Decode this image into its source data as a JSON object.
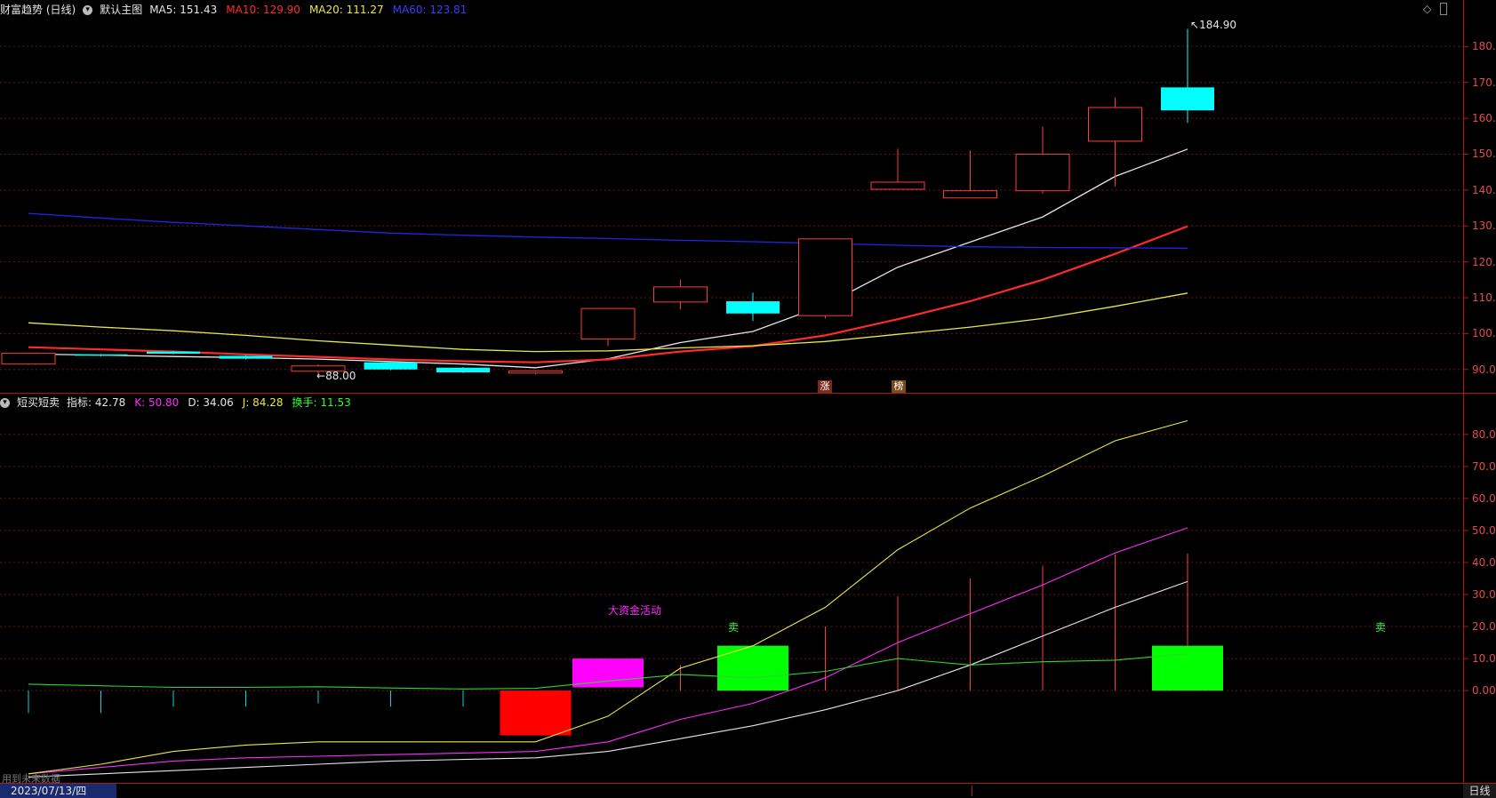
{
  "upper_panel": {
    "title": "财富趋势 (日线)",
    "menu_label": "默认主图",
    "ma": [
      {
        "label": "MA5: 151.43",
        "color": "#e6e6e6"
      },
      {
        "label": "MA10: 129.90",
        "color": "#ff2a2a"
      },
      {
        "label": "MA20: 111.27",
        "color": "#e8e84a"
      },
      {
        "label": "MA60: 123.81",
        "color": "#3b3bff"
      }
    ],
    "y_ticks": [
      "180.00",
      "170.00",
      "160.00",
      "150.00",
      "140.00",
      "130.00",
      "120.00",
      "110.00",
      "100.00",
      "90.00"
    ],
    "high_label": "184.90",
    "low_label": "88.00",
    "tags": [
      {
        "text": "涨"
      },
      {
        "text": "榜"
      }
    ]
  },
  "lower_panel": {
    "title": "短买短卖",
    "indicators": [
      {
        "label": "指标: 42.78",
        "color": "#e6e6e6"
      },
      {
        "label": "K: 50.80",
        "color": "#ff2aff"
      },
      {
        "label": "D: 34.06",
        "color": "#e6e6e6"
      },
      {
        "label": "J: 84.28",
        "color": "#e8e84a"
      },
      {
        "label": "换手: 11.53",
        "color": "#2aff2a"
      }
    ],
    "y_ticks": [
      "80.00",
      "70.00",
      "60.00",
      "50.00",
      "40.00",
      "30.00",
      "20.00",
      "10.00",
      "0.00"
    ],
    "annotation": "大资金活动",
    "sell_label_1": "卖",
    "sell_label_2": "卖"
  },
  "status_bar": {
    "date": "2023/07/13/四",
    "period": "日线",
    "hint": "用到未来数据"
  },
  "colors": {
    "up": "#ff3a3a",
    "down": "#00ffff",
    "grid": "#6e1414",
    "axis": "#b01818"
  },
  "chart_data": [
    {
      "type": "candlestick",
      "title": "财富趋势 (日线)",
      "ylim": [
        84,
        188
      ],
      "candles": [
        {
          "o": 91.5,
          "c": 94.5,
          "h": 94.7,
          "l": 91.3
        },
        {
          "o": 94.2,
          "c": 93.9,
          "h": 94.3,
          "l": 93.7
        },
        {
          "o": 95.0,
          "c": 94.4,
          "h": 95.2,
          "l": 94.2
        },
        {
          "o": 93.8,
          "c": 93.0,
          "h": 94.0,
          "l": 92.8
        },
        {
          "o": 89.5,
          "c": 91.0,
          "h": 91.5,
          "l": 88.0
        },
        {
          "o": 92.0,
          "c": 90.0,
          "h": 92.2,
          "l": 89.8
        },
        {
          "o": 90.5,
          "c": 89.2,
          "h": 90.7,
          "l": 89.0
        },
        {
          "o": 89.0,
          "c": 89.6,
          "h": 89.8,
          "l": 88.6
        },
        {
          "o": 98.5,
          "c": 107.0,
          "h": 107.0,
          "l": 96.5
        },
        {
          "o": 108.8,
          "c": 113.0,
          "h": 115.0,
          "l": 106.8
        },
        {
          "o": 109.0,
          "c": 105.6,
          "h": 111.4,
          "l": 103.5
        },
        {
          "o": 105.0,
          "c": 126.4,
          "h": 126.4,
          "l": 104.2
        },
        {
          "o": 140.2,
          "c": 142.2,
          "h": 151.5,
          "l": 140.2
        },
        {
          "o": 137.8,
          "c": 139.8,
          "h": 151.0,
          "l": 137.8
        },
        {
          "o": 139.8,
          "c": 150.0,
          "h": 157.7,
          "l": 139.0
        },
        {
          "o": 153.6,
          "c": 163.0,
          "h": 165.8,
          "l": 141.0
        },
        {
          "o": 168.6,
          "c": 162.2,
          "h": 184.9,
          "l": 158.7
        }
      ],
      "series": [
        {
          "name": "MA5",
          "values": [
            94.3,
            94.0,
            93.6,
            93.3,
            92.9,
            92.2,
            91.5,
            90.5,
            93.0,
            97.5,
            100.6,
            108.0,
            118.5,
            125.5,
            132.5,
            143.8,
            151.4
          ]
        },
        {
          "name": "MA10",
          "values": [
            96.2,
            95.6,
            95.0,
            94.2,
            93.5,
            92.8,
            92.3,
            92.0,
            92.8,
            95.0,
            96.5,
            99.5,
            104.0,
            109.0,
            115.0,
            122.2,
            129.9
          ]
        },
        {
          "name": "MA20",
          "values": [
            103.0,
            101.8,
            100.8,
            99.5,
            98.0,
            96.8,
            95.6,
            95.0,
            95.2,
            96.0,
            96.6,
            97.8,
            99.8,
            101.8,
            104.2,
            107.6,
            111.3
          ]
        },
        {
          "name": "MA60",
          "values": [
            133.5,
            132.2,
            131.0,
            130.0,
            129.0,
            128.0,
            127.4,
            126.9,
            126.5,
            126.0,
            125.6,
            125.1,
            124.6,
            124.2,
            124.0,
            123.9,
            123.8
          ]
        }
      ]
    },
    {
      "type": "line",
      "title": "短买短卖",
      "ylim": [
        -28,
        88
      ],
      "series": [
        {
          "name": "K",
          "values": [
            -26,
            -24,
            -22,
            -21,
            -20.5,
            -20,
            -19.5,
            -19,
            -16,
            -9,
            -4,
            4,
            15,
            24,
            33,
            43,
            50.8
          ]
        },
        {
          "name": "D",
          "values": [
            -27,
            -26,
            -25,
            -24,
            -23,
            -22,
            -21.5,
            -21,
            -19,
            -15,
            -11,
            -6,
            0,
            8,
            17,
            26,
            34.06
          ]
        },
        {
          "name": "J",
          "values": [
            -26,
            -23,
            -19,
            -17,
            -16,
            -16,
            -16,
            -16,
            -8,
            7,
            14,
            26,
            44,
            57,
            67,
            78,
            84.28
          ]
        },
        {
          "name": "换手",
          "values": [
            2,
            1.5,
            1,
            1,
            1.2,
            0.8,
            0.5,
            0.7,
            3,
            5,
            4,
            6,
            10,
            8,
            9,
            9.5,
            11.53
          ]
        }
      ],
      "bars": [
        {
          "kind": "cyan",
          "value": -7
        },
        {
          "kind": "cyan",
          "value": -7
        },
        {
          "kind": "cyan",
          "value": -5
        },
        {
          "kind": "cyan",
          "value": -5
        },
        {
          "kind": "cyan",
          "value": -4
        },
        {
          "kind": "cyan",
          "value": -5
        },
        {
          "kind": "cyan",
          "value": -5
        },
        {
          "kind": "red",
          "value": 0
        },
        {
          "kind": "red",
          "value": 0
        },
        {
          "kind": "red",
          "value": 8
        },
        {
          "kind": "red",
          "value": 0
        },
        {
          "kind": "red",
          "value": 20
        },
        {
          "kind": "red",
          "value": 29.5
        },
        {
          "kind": "red",
          "value": 35
        },
        {
          "kind": "red",
          "value": 39
        },
        {
          "kind": "red",
          "value": 42.5
        },
        {
          "kind": "red",
          "value": 42.78
        }
      ],
      "blocks": [
        {
          "kind": "red",
          "center": 7,
          "top": 0,
          "bottom": -14
        },
        {
          "kind": "magenta",
          "center": 8,
          "top": 10,
          "bottom": 1
        },
        {
          "kind": "green",
          "center": 10,
          "top": 14,
          "bottom": 0
        },
        {
          "kind": "green",
          "center": 16,
          "top": 14,
          "bottom": 0
        }
      ]
    }
  ]
}
